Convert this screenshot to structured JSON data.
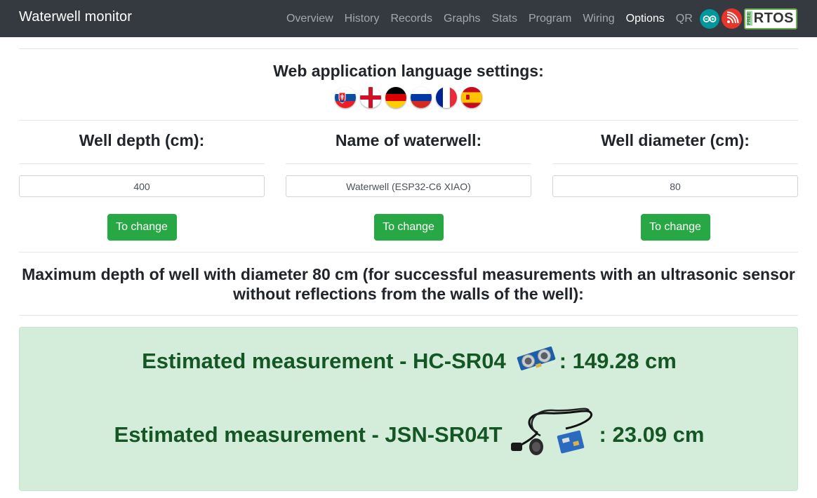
{
  "navbar": {
    "brand": "Waterwell monitor",
    "links": [
      {
        "label": "Overview",
        "active": false
      },
      {
        "label": "History",
        "active": false
      },
      {
        "label": "Records",
        "active": false
      },
      {
        "label": "Graphs",
        "active": false
      },
      {
        "label": "Stats",
        "active": false
      },
      {
        "label": "Program",
        "active": false
      },
      {
        "label": "Wiring",
        "active": false
      },
      {
        "label": "Options",
        "active": true
      },
      {
        "label": "QR",
        "active": false
      }
    ],
    "icons": {
      "rtos_small_text": "FREE",
      "rtos_text": "RTOS"
    }
  },
  "language": {
    "title": "Web application language settings:",
    "flags": [
      "slovak-flag-icon",
      "english-flag-icon",
      "german-flag-icon",
      "russian-flag-icon",
      "french-flag-icon",
      "spanish-flag-icon"
    ]
  },
  "settings": [
    {
      "heading": "Well depth (cm):",
      "value": "400",
      "button": "To change"
    },
    {
      "heading": "Name of waterwell:",
      "value": "Waterwell (ESP32-C6 XIAO)",
      "button": "To change"
    },
    {
      "heading": "Well diameter (cm):",
      "value": "80",
      "button": "To change"
    }
  ],
  "max_depth": {
    "line1": "Maximum depth of well with diameter 80 cm (for successful measurements with an ultrasonic sensor",
    "line2": "without reflections from the walls of the well):"
  },
  "estimates": [
    {
      "label": "Estimated measurement - HC-SR04",
      "value": ": 149.28 cm"
    },
    {
      "label": "Estimated measurement - JSN-SR04T",
      "value": ": 23.09 cm"
    }
  ],
  "colors": {
    "navbar_bg": "#343a40",
    "button_green": "#28a745",
    "alert_bg": "#d4edda",
    "alert_text": "#155724"
  }
}
